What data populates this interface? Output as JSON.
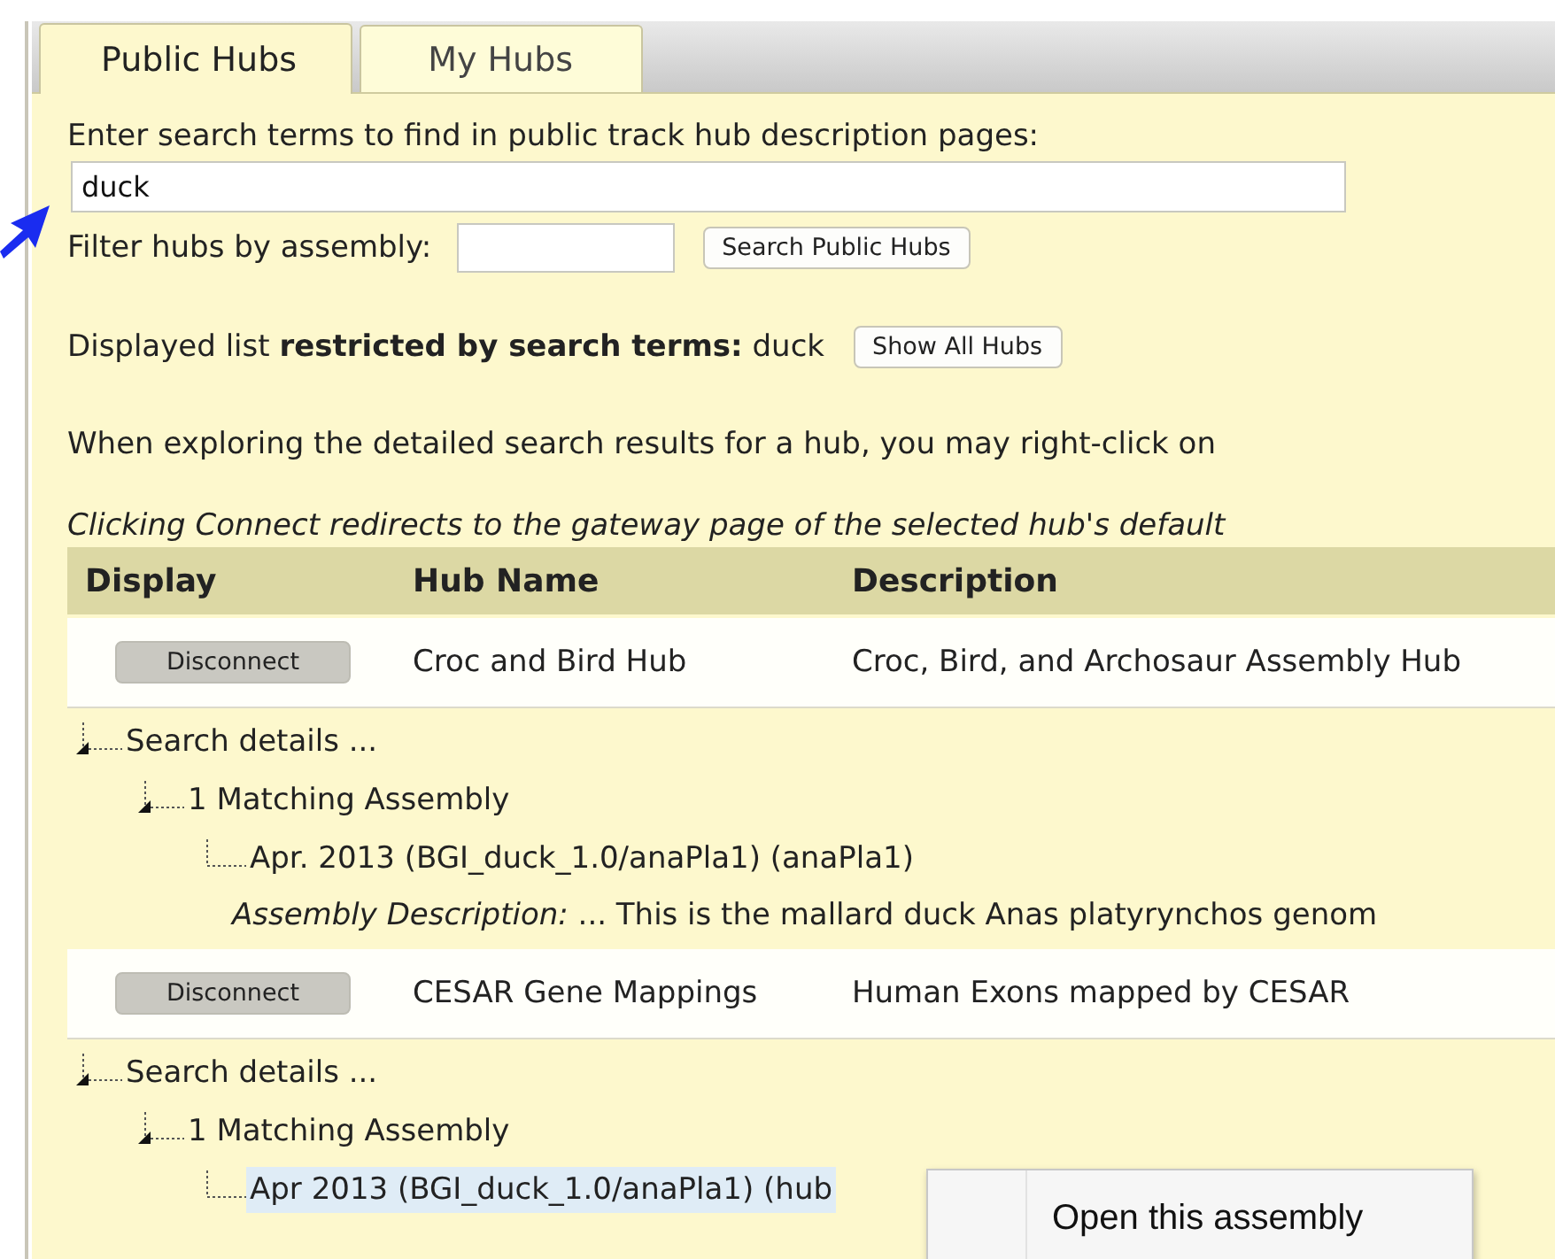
{
  "tabs": [
    {
      "label": "Public Hubs",
      "selected": true
    },
    {
      "label": "My Hubs",
      "selected": false
    }
  ],
  "search": {
    "prompt": "Enter search terms to find in public track hub description pages:",
    "value": "duck",
    "filter_label": "Filter hubs by assembly:",
    "button": "Search Public Hubs"
  },
  "restriction": {
    "text": "Displayed list **restricted by search terms:** duck",
    "button": "Show All Hubs"
  },
  "hint": "When exploring the detailed search results for a hub, you may right-click on",
  "note": "Clicking Connect redirects to the gateway page of the selected hub's default",
  "table": {
    "columns": [
      "Display",
      "Hub Name",
      "Description"
    ],
    "rows": [
      {
        "button": "Disconnect",
        "hub_name": "Croc and Bird Hub",
        "description": "Croc, Bird, and Archosaur Assembly Hub",
        "details": {
          "label": "Search details ...",
          "expanded": true,
          "children": [
            {
              "label": "1 Matching Assembly",
              "expanded": true,
              "children": [
                {
                  "label": "Apr. 2013 (BGI_duck_1.0/anaPla1) (anaPla1)",
                  "selected": false,
                  "note": "*Assembly Description:* ... This is the mallard duck Anas platyrynchos genom"
                }
              ]
            }
          ]
        }
      },
      {
        "button": "Disconnect",
        "hub_name": "CESAR Gene Mappings",
        "description": "Human Exons mapped by CESAR",
        "details": {
          "label": "Search details ...",
          "expanded": true,
          "children": [
            {
              "label": "1 Matching Assembly",
              "expanded": true,
              "children": [
                {
                  "label": "Apr 2013 (BGI_duck_1.0/anaPla1) (hub",
                  "selected": true
                }
              ]
            }
          ]
        }
      }
    ]
  },
  "context_menu": {
    "items": [
      {
        "label": "Open this assembly"
      }
    ]
  }
}
